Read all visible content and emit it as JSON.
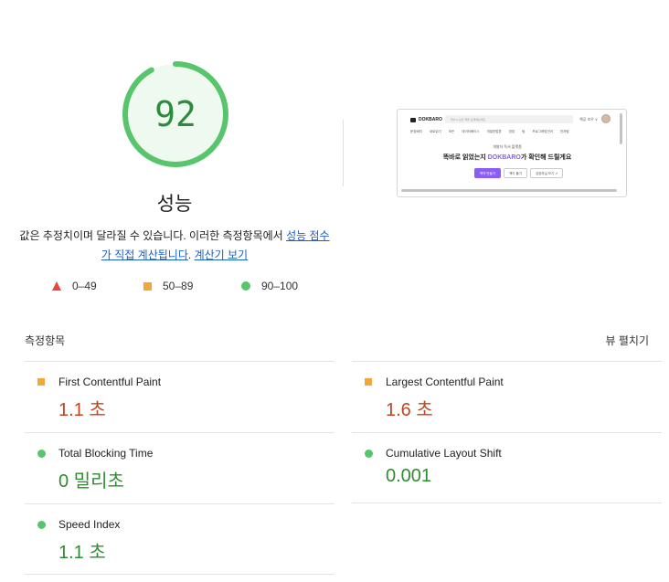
{
  "gauge": {
    "score": "92",
    "score_fraction": 0.92,
    "title": "성능",
    "ring_color": "#58c56c",
    "fill_color": "#eef9f0"
  },
  "description": {
    "prefix": "값은 추정치이며 달라질 수 있습니다. 이러한 측정항목에서 ",
    "link1": "성능 점수가 직접 계산됩니다",
    "middle": ". ",
    "link2": "계산기 보기"
  },
  "legend": [
    {
      "shape": "triangle",
      "color": "#e8453c",
      "label": "0–49"
    },
    {
      "shape": "square",
      "color": "#f2a73b",
      "label": "50–89"
    },
    {
      "shape": "circle",
      "color": "#58c56c",
      "label": "90–100"
    }
  ],
  "thumbnail": {
    "logo": "DOKBARO",
    "search_placeholder": "책이 Z 상인 책을 검색해보세요",
    "user": "책공 조우 ∨",
    "nav": [
      "문장배치",
      "새로읽기",
      "모든",
      "데이터베이스",
      "개발방법론",
      "영업",
      "팀",
      "프로그래밍언어",
      "전처럼"
    ],
    "sub": "개발자 독서 플랫폼",
    "headline_pre": "똑바로 읽었는지 ",
    "headline_brand": "DOKBARO",
    "headline_post": "가 확인해 드릴게요",
    "buttons": [
      "책약 만들기",
      "책이 풀기",
      "성공하실 보기 ↗"
    ]
  },
  "metrics": {
    "title": "측정항목",
    "expand_label": "뷰 펼치기",
    "items": [
      {
        "label": "First Contentful Paint",
        "value": "1.1 초",
        "status": "average"
      },
      {
        "label": "Largest Contentful Paint",
        "value": "1.6 초",
        "status": "average"
      },
      {
        "label": "Total Blocking Time",
        "value": "0 밀리초",
        "status": "good"
      },
      {
        "label": "Cumulative Layout Shift",
        "value": "0.001",
        "status": "good"
      },
      {
        "label": "Speed Index",
        "value": "1.1 초",
        "status": "good"
      }
    ]
  }
}
